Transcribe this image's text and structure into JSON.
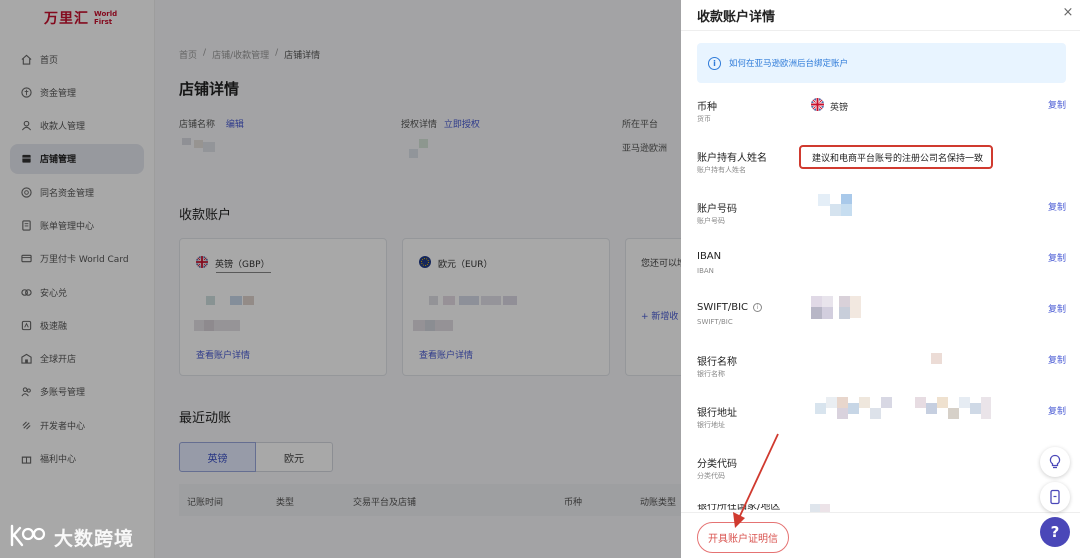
{
  "brand": {
    "name_cn": "万里汇",
    "name_en_1": "World",
    "name_en_2": "First",
    "color": "#c8102e"
  },
  "sidebar": {
    "items": [
      {
        "label": "首页",
        "icon": "home-icon"
      },
      {
        "label": "资金管理",
        "icon": "funds-icon"
      },
      {
        "label": "收款人管理",
        "icon": "payee-icon"
      },
      {
        "label": "店铺管理",
        "icon": "store-icon",
        "active": true
      },
      {
        "label": "同名资金管理",
        "icon": "same-name-icon"
      },
      {
        "label": "账单管理中心",
        "icon": "bill-icon"
      },
      {
        "label": "万里付卡 World Card",
        "icon": "card-icon"
      },
      {
        "label": "安心兑",
        "icon": "exchange-icon"
      },
      {
        "label": "极速融",
        "icon": "finance-icon"
      },
      {
        "label": "全球开店",
        "icon": "global-store-icon"
      },
      {
        "label": "多账号管理",
        "icon": "multi-account-icon"
      },
      {
        "label": "开发者中心",
        "icon": "developer-icon"
      },
      {
        "label": "福利中心",
        "icon": "gift-icon"
      }
    ]
  },
  "main": {
    "breadcrumb": [
      "首页",
      "店铺/收款管理",
      "店铺详情"
    ],
    "title": "店铺详情",
    "store_name_label": "店铺名称",
    "store_name_edit": "编辑",
    "auth_label": "授权详情",
    "auth_link": "立即授权",
    "platform_label": "所在平台",
    "platform_value": "亚马逊欧洲",
    "accounts_title": "收款账户",
    "cards": [
      {
        "currency": "英镑（GBP）",
        "detail_link": "查看账户详情"
      },
      {
        "currency": "欧元（EUR）",
        "detail_link": "查看账户详情"
      }
    ],
    "card3_text": "您还可以增",
    "card3_add": "+ 新增收",
    "recent_title": "最近动账",
    "tabs": [
      "英镑",
      "欧元"
    ],
    "table_headers": [
      "记账时间",
      "类型",
      "交易平台及店铺",
      "币种",
      "动账类型"
    ]
  },
  "drawer": {
    "title": "收款账户详情",
    "close": "×",
    "tip": "如何在亚马逊欧洲后台绑定账户",
    "copy_label": "复制",
    "fields": [
      {
        "label": "币种",
        "sub": "货币",
        "value": "英镑",
        "copy": true
      },
      {
        "label": "账户持有人姓名",
        "sub": "账户持有人姓名",
        "copy": false
      },
      {
        "label": "账户号码",
        "sub": "账户号码",
        "copy": true
      },
      {
        "label": "IBAN",
        "sub": "IBAN",
        "copy": true
      },
      {
        "label": "SWIFT/BIC",
        "sub": "SWIFT/BIC",
        "copy": true
      },
      {
        "label": "银行名称",
        "sub": "银行名称",
        "copy": true
      },
      {
        "label": "银行地址",
        "sub": "银行地址",
        "copy": true
      },
      {
        "label": "分类代码",
        "sub": "分类代码",
        "copy": false
      },
      {
        "label": "银行所在国家/地区",
        "sub": "",
        "copy": false
      }
    ],
    "annotation": "建议和电商平台账号的注册公司名保持一致",
    "cert_button": "开具账户证明信"
  },
  "watermark": {
    "text": "大数跨境",
    "logo": "k2b-logo"
  },
  "colors": {
    "accent": "#4a5bd4",
    "annotation_red": "#d03a2f",
    "help_purple": "#4a47b8"
  }
}
